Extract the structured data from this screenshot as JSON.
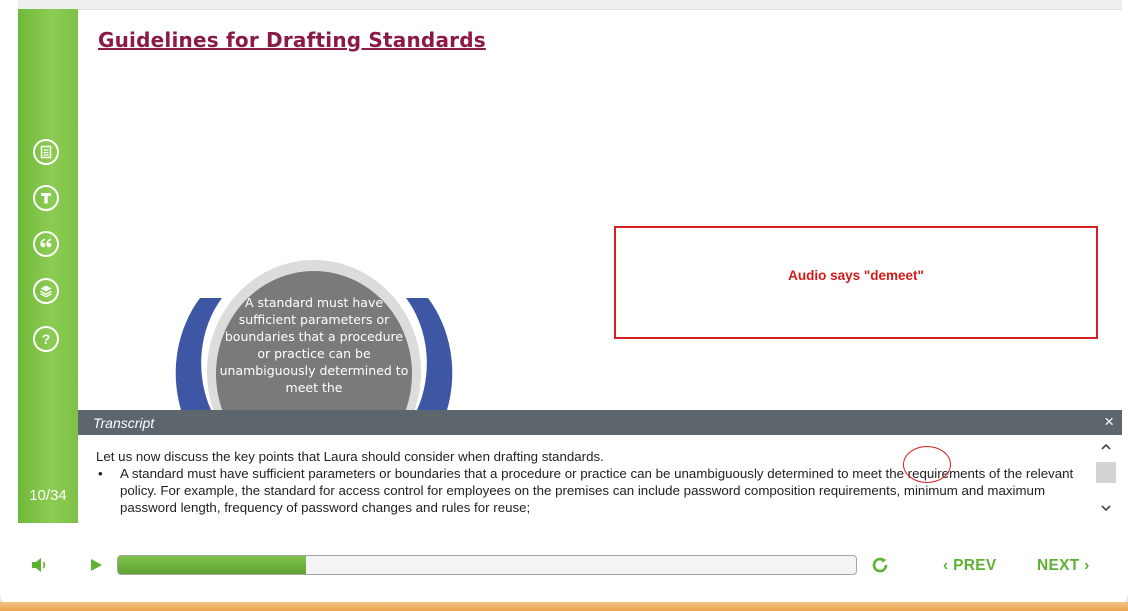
{
  "slide": {
    "title": "Guidelines for Drafting Standards",
    "circle_text": "A standard must have sufficient parameters or boundaries that a procedure or practice can be unambiguously determined to meet the"
  },
  "sidebar": {
    "icons": [
      "notes-icon",
      "transcript-icon",
      "quote-icon",
      "resources-icon",
      "help-icon"
    ],
    "slide_counter": "10/34"
  },
  "annotation": {
    "text": "Audio says \"demeet\""
  },
  "transcript": {
    "title": "Transcript",
    "close_label": "×",
    "intro": "Let us now discuss the key points that Laura should consider when drafting standards.",
    "bullet_marker": "•",
    "bullet_1": "A standard must have sufficient parameters or boundaries that a procedure or practice can be unambiguously determined to meet the requirements of the relevant policy. For example, the standard for access control for employees on the premises can include password composition requirements, minimum and maximum password length, frequency of password changes and rules for reuse;"
  },
  "player": {
    "progress_fraction": 0.255,
    "prev_label": "‹ PREV",
    "next_label": "NEXT ›"
  },
  "colors": {
    "accent_green": "#6ab43c",
    "title_color": "#8b1a45",
    "annotation_red": "#d42020",
    "transcript_header": "#5d666d"
  }
}
